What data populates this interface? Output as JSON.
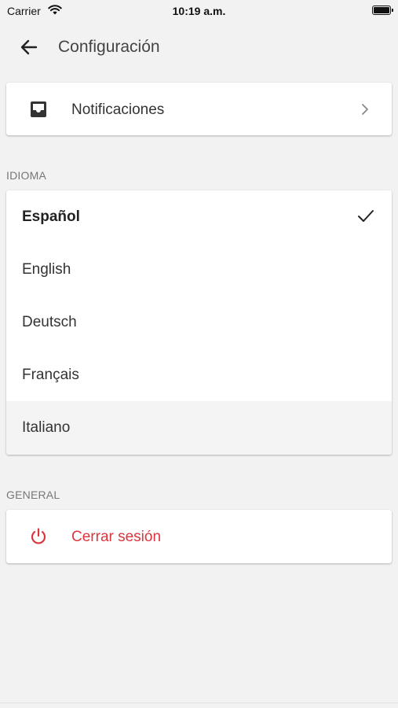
{
  "status_bar": {
    "carrier": "Carrier",
    "time": "10:19 a.m."
  },
  "header": {
    "title": "Configuración",
    "back_icon": "arrow-left-icon"
  },
  "notifications": {
    "label": "Notificaciones",
    "icon": "inbox-icon"
  },
  "language_section": {
    "header": "IDIOMA",
    "items": [
      {
        "label": "Español",
        "selected": true
      },
      {
        "label": "English",
        "selected": false
      },
      {
        "label": "Deutsch",
        "selected": false
      },
      {
        "label": "Français",
        "selected": false
      },
      {
        "label": "Italiano",
        "selected": false
      }
    ]
  },
  "general_section": {
    "header": "GENERAL",
    "logout_label": "Cerrar sesión",
    "logout_icon": "power-icon"
  },
  "colors": {
    "background": "#f2f2f2",
    "card": "#ffffff",
    "danger": "#d9363e",
    "text": "#333333",
    "section_label": "#777777"
  }
}
